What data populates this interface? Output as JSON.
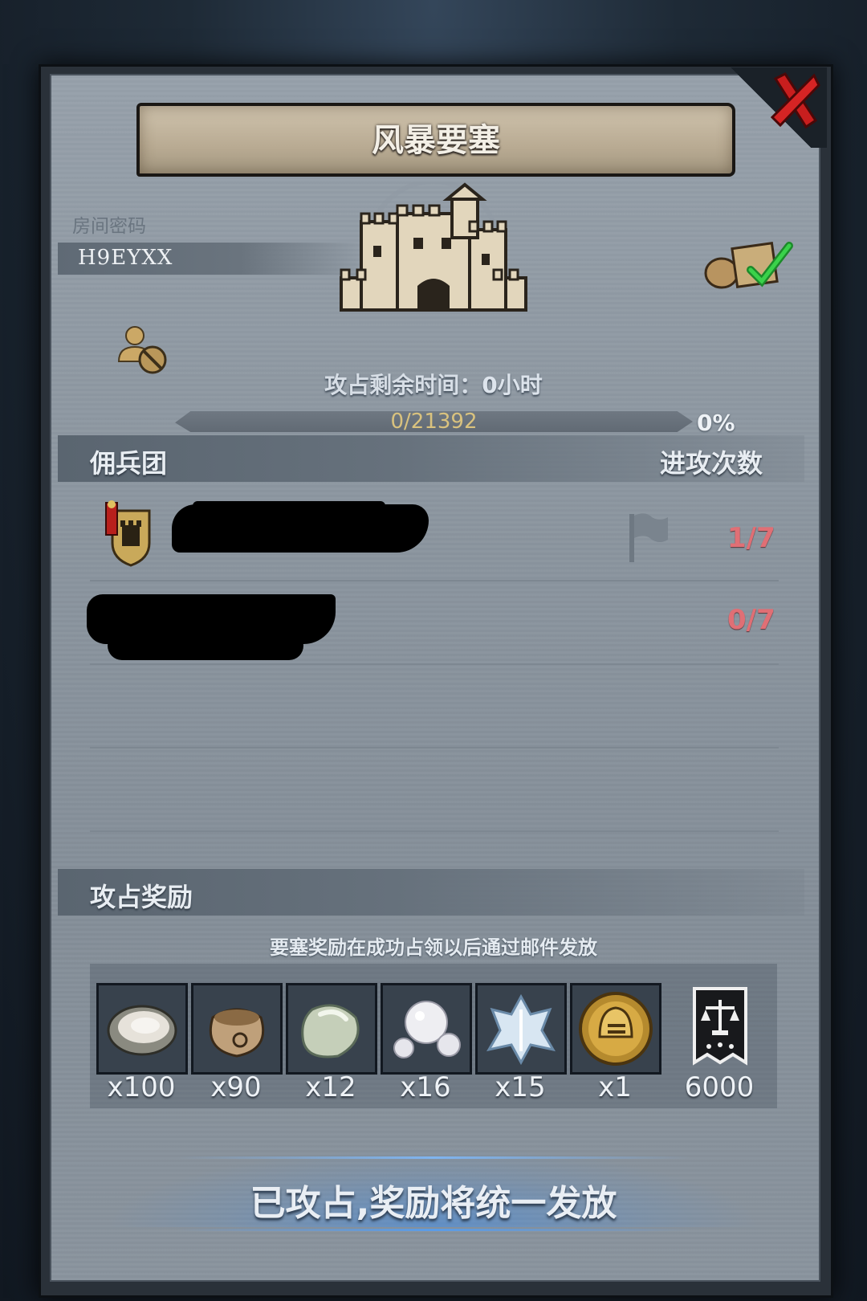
{
  "title": "风暴要塞",
  "room": {
    "label": "房间密码",
    "code": "H9EYXX"
  },
  "remaining_time": {
    "label": "攻占剩余时间：",
    "value": "0小时"
  },
  "progress": {
    "text": "0/21392",
    "percent_text": "0%",
    "fraction": 0.0
  },
  "mercenary_section": {
    "title": "佣兵团",
    "column_label": "进攻次数"
  },
  "mercenaries": [
    {
      "attacks": "1/7",
      "has_badge": true,
      "has_flag": true
    },
    {
      "attacks": "0/7",
      "has_badge": false,
      "has_flag": false
    }
  ],
  "reward_section": {
    "title": "攻占奖励",
    "note": "要塞奖励在成功占领以后通过邮件发放"
  },
  "rewards": [
    {
      "icon": "oyster-icon",
      "qty": "x100"
    },
    {
      "icon": "sack-icon",
      "qty": "x90"
    },
    {
      "icon": "gem-stone-icon",
      "qty": "x12"
    },
    {
      "icon": "pearl-icon",
      "qty": "x16"
    },
    {
      "icon": "ice-crystal-icon",
      "qty": "x15"
    },
    {
      "icon": "knight-helmet-medal-icon",
      "qty": "x1"
    },
    {
      "icon": "justice-banner-icon",
      "qty": "6000"
    }
  ],
  "bottom_status": "已攻占,奖励将统一发放",
  "colors": {
    "attack_count": "#e06f75",
    "progress_text": "#d9c27e",
    "banner": "#c4b8a0"
  }
}
